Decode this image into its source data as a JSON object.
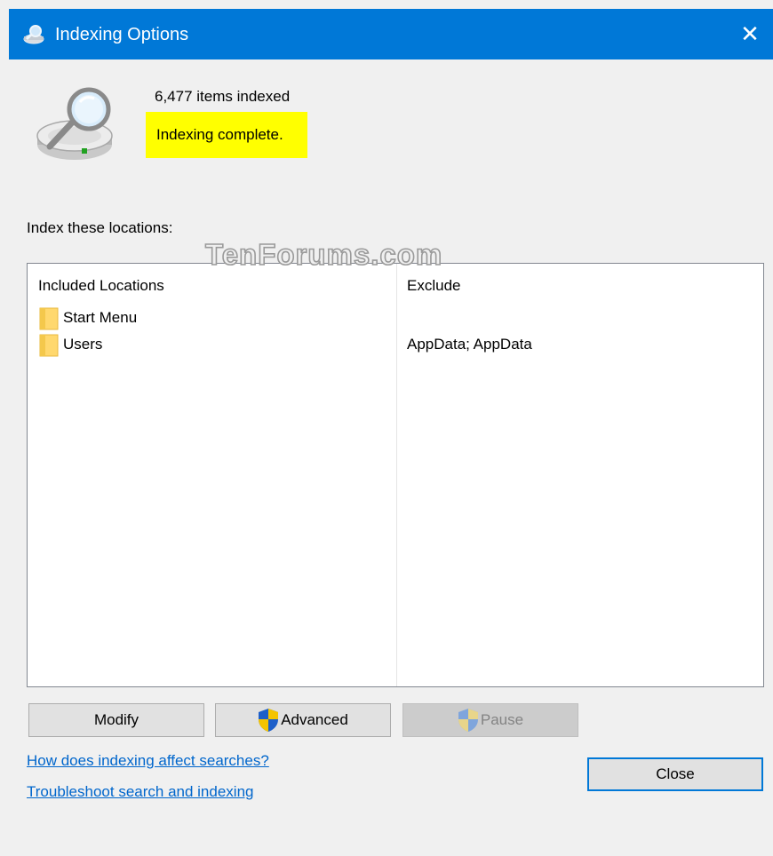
{
  "window": {
    "title": "Indexing Options",
    "close_glyph": "✕"
  },
  "status": {
    "items_indexed": "6,477 items indexed",
    "state": "Indexing complete.",
    "highlight_color": "#ffff00"
  },
  "locations": {
    "section_label": "Index these locations:",
    "watermark": "TenForums.com",
    "columns": [
      "Included Locations",
      "Exclude"
    ],
    "rows": [
      {
        "included": "Start Menu",
        "exclude": ""
      },
      {
        "included": "Users",
        "exclude": "AppData; AppData"
      }
    ]
  },
  "buttons": {
    "modify": "Modify",
    "advanced": "Advanced",
    "pause": "Pause",
    "close": "Close"
  },
  "links": {
    "help": "How does indexing affect searches?",
    "troubleshoot": "Troubleshoot search and indexing"
  },
  "colors": {
    "titlebar": "#0078d7",
    "link": "#0066cc"
  }
}
